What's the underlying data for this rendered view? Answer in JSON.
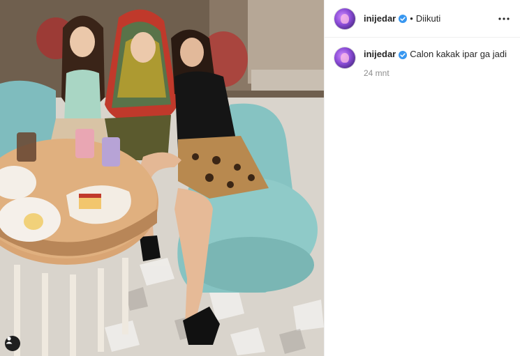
{
  "post": {
    "username": "inijedar",
    "verified": true,
    "follow_status": "Diikuti",
    "separator": "•",
    "more_icon": "more-horizontal-icon",
    "caption": {
      "username": "inijedar",
      "text": "Calon kakak ipar ga jadi",
      "time": "24 mnt"
    },
    "photo_tag_icon": "user-tag-icon"
  },
  "colors": {
    "verified_blue": "#3897f0",
    "text": "#262626",
    "muted": "#8e8e8e",
    "border": "#efefef"
  }
}
